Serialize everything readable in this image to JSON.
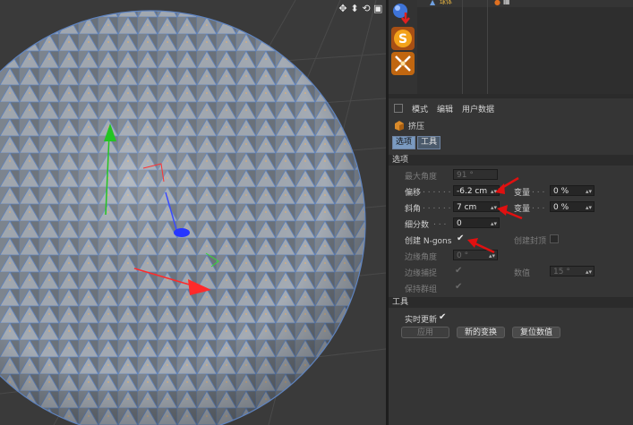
{
  "viewport": {
    "nav_icons": [
      "move-view-icon",
      "zoom-view-icon",
      "rotate-view-icon",
      "maximize-view-icon"
    ]
  },
  "toolbar": {
    "tools": [
      "sphere-object-icon",
      "subdivision-s-icon",
      "extrude-tool-icon"
    ]
  },
  "object_manager": {
    "object_name": "球体"
  },
  "attributes": {
    "menu": [
      "模式",
      "编辑",
      "用户数据"
    ],
    "object_title": "挤压",
    "tabs": [
      "选项",
      "工具"
    ],
    "options_section": "选项",
    "max_angle": {
      "label": "最大角度",
      "value": "91 °"
    },
    "offset": {
      "label": "偏移",
      "value": "-6.2 cm"
    },
    "offset_var": {
      "label": "变量",
      "value": "0 %"
    },
    "bevel": {
      "label": "斜角",
      "value": "7 cm"
    },
    "bevel_var": {
      "label": "变量",
      "value": "0 %"
    },
    "subdivision": {
      "label": "细分数",
      "value": "0"
    },
    "create_ngons": {
      "label": "创建 N-gons",
      "checked": true
    },
    "create_caps": {
      "label": "创建封顶",
      "checked": false
    },
    "edge_angle": {
      "label": "边缘角度",
      "value": "0 °"
    },
    "edge_snap": {
      "label": "边缘捕捉",
      "checked": true
    },
    "value": {
      "label": "数值",
      "value": "15 °"
    },
    "keep_groups": {
      "label": "保持群组",
      "checked": true
    },
    "tool_section": "工具",
    "realtime_update": {
      "label": "实时更新",
      "checked": true
    },
    "buttons": {
      "apply": "应用",
      "new_transform": "新的变换",
      "reset_values": "复位数值"
    }
  },
  "colors": {
    "accent": "#7a9ac0",
    "arrow": "#e01010",
    "mesh_face": "#8c939c",
    "mesh_edge": "#5f84c0"
  }
}
